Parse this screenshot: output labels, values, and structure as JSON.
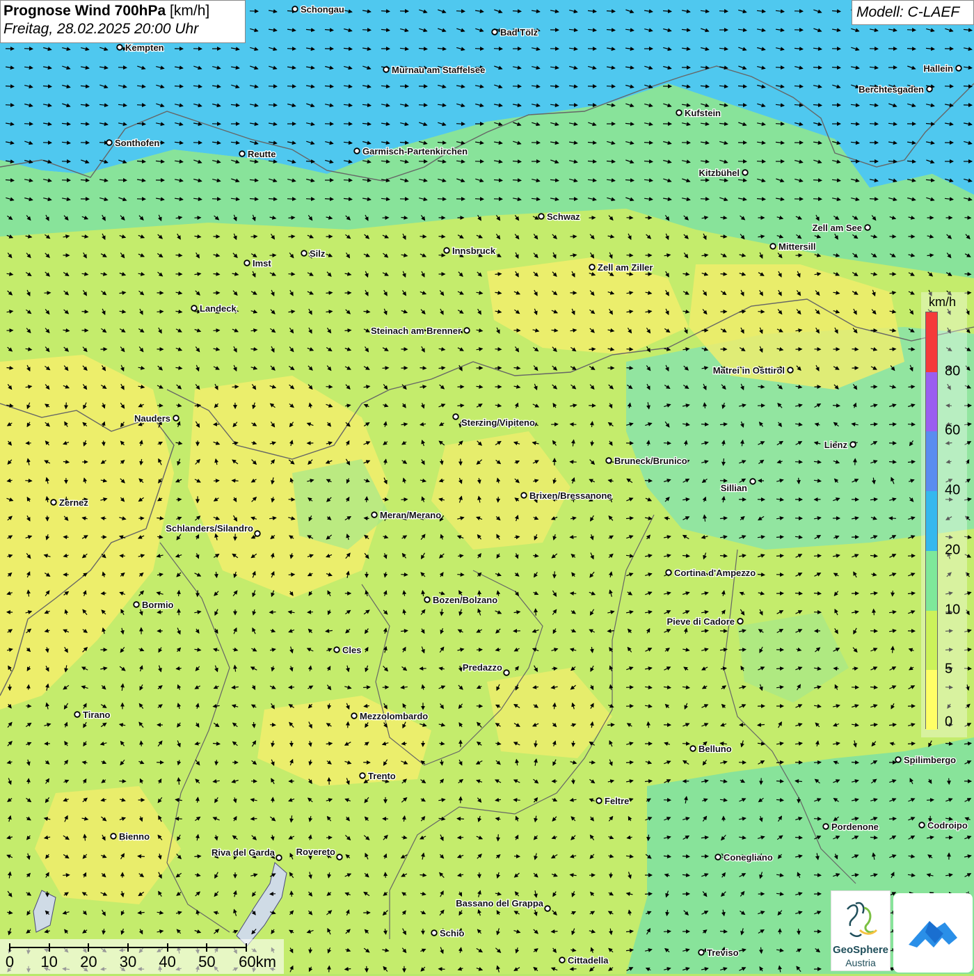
{
  "header": {
    "title_bold": "Prognose Wind 700hPa",
    "title_unit": "[km/h]",
    "datetime": "Freitag, 28.02.2025 20:00 Uhr",
    "model": "Modell: C-LAEF"
  },
  "legend": {
    "unit": "km/h",
    "ticks": [
      "0",
      "5",
      "10",
      "20",
      "40",
      "60",
      "80"
    ],
    "colors": [
      "#ffff66",
      "#ccf25a",
      "#7ee89a",
      "#35b8ee",
      "#5a8cf0",
      "#9a5ef0",
      "#f53a3a"
    ]
  },
  "scale_bar": {
    "labels": [
      "0",
      "10",
      "20",
      "30",
      "40",
      "50",
      "60km"
    ]
  },
  "logos": {
    "geosphere_line1": "GeoSphere",
    "geosphere_line2": "Austria",
    "app_icon": "weather-app-icon"
  },
  "map": {
    "wind_direction": "west-to-east in north, variable in south",
    "field_colors": {
      "calm": "#f5f06a",
      "light": "#c4ec6c",
      "moderate": "#88e39a",
      "strong": "#4fc8ef"
    },
    "cities": [
      {
        "name": "Schongau"
      },
      {
        "name": "Bad Tölz"
      },
      {
        "name": "Kempten"
      },
      {
        "name": "Murnau am Staffelsee"
      },
      {
        "name": "Hallein"
      },
      {
        "name": "Berchtesgaden"
      },
      {
        "name": "Kufstein"
      },
      {
        "name": "Sonthofen"
      },
      {
        "name": "Reutte"
      },
      {
        "name": "Garmisch-Partenkirchen"
      },
      {
        "name": "Kitzbühel"
      },
      {
        "name": "Schwaz"
      },
      {
        "name": "Zell am See"
      },
      {
        "name": "Mittersill"
      },
      {
        "name": "Imst"
      },
      {
        "name": "Silz"
      },
      {
        "name": "Innsbruck"
      },
      {
        "name": "Zell am Ziller"
      },
      {
        "name": "Landeck"
      },
      {
        "name": "Steinach am Brenner"
      },
      {
        "name": "Matrei in Osttirol"
      },
      {
        "name": "Nauders"
      },
      {
        "name": "Sterzing/Vipiteno"
      },
      {
        "name": "Lienz"
      },
      {
        "name": "Bruneck/Brunico"
      },
      {
        "name": "Sillian"
      },
      {
        "name": "Zernez"
      },
      {
        "name": "Brixen/Bressanone"
      },
      {
        "name": "Meran/Merano"
      },
      {
        "name": "Schlanders/Silandro"
      },
      {
        "name": "Cortina d'Ampezzo"
      },
      {
        "name": "Bozen/Bolzano"
      },
      {
        "name": "Bormio"
      },
      {
        "name": "Pieve di Cadore"
      },
      {
        "name": "Cles"
      },
      {
        "name": "Predazzo"
      },
      {
        "name": "Tirano"
      },
      {
        "name": "Mezzolombardo"
      },
      {
        "name": "Belluno"
      },
      {
        "name": "Spilimbergo"
      },
      {
        "name": "Trento"
      },
      {
        "name": "Feltre"
      },
      {
        "name": "Pordenone"
      },
      {
        "name": "Codroipo"
      },
      {
        "name": "Bienno"
      },
      {
        "name": "Riva del Garda"
      },
      {
        "name": "Rovereto"
      },
      {
        "name": "Conegliano"
      },
      {
        "name": "Bassano del Grappa"
      },
      {
        "name": "Schio"
      },
      {
        "name": "Treviso"
      },
      {
        "name": "Cittadella"
      }
    ]
  }
}
